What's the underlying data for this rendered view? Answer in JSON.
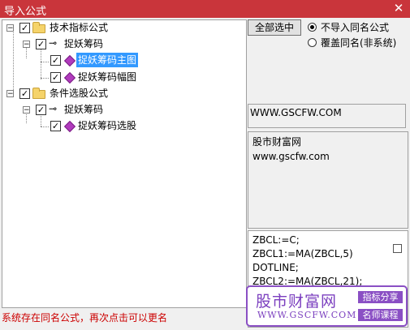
{
  "window": {
    "title": "导入公式",
    "close_glyph": "✕"
  },
  "tree": {
    "nodes": [
      {
        "label": "技术指标公式",
        "checked": true,
        "expanded": true
      },
      {
        "label": "捉妖筹码",
        "checked": true,
        "expanded": true
      },
      {
        "label": "捉妖筹码主图",
        "checked": true,
        "selected": true
      },
      {
        "label": "捉妖筹码幅图",
        "checked": true
      },
      {
        "label": "条件选股公式",
        "checked": true,
        "expanded": true
      },
      {
        "label": "捉妖筹码",
        "checked": true,
        "expanded": true
      },
      {
        "label": "捉妖筹码选股",
        "checked": true
      }
    ],
    "check_glyph": "✓",
    "expand_glyph": "−"
  },
  "options": {
    "select_all_label": "全部选中",
    "radio_no_import_label": "不导入同名公式",
    "radio_overwrite_label": "覆盖同名(非系统)",
    "selected": "no_import"
  },
  "url_box": {
    "text": "WWW.GSCFW.COM"
  },
  "info_box": {
    "line1": "股市财富网",
    "line2": "www.gscfw.com"
  },
  "code_box": {
    "lines": [
      "ZBCL:=C;",
      "ZBCL1:=MA(ZBCL,5)",
      "DOTLINE;",
      "ZBCL2:=MA(ZBCL,21);"
    ]
  },
  "watermark": {
    "brand": "股市财富网",
    "url": "WWW.GSCFW.COM",
    "tag1": "指标分享",
    "tag2": "名师课程",
    "color": "#8a4fc4"
  },
  "status": {
    "text": "系统存在同名公式，再次点击可以更名",
    "color": "#cc0000"
  },
  "colors": {
    "titlebar": "#c9353b",
    "selection": "#3399ff"
  }
}
